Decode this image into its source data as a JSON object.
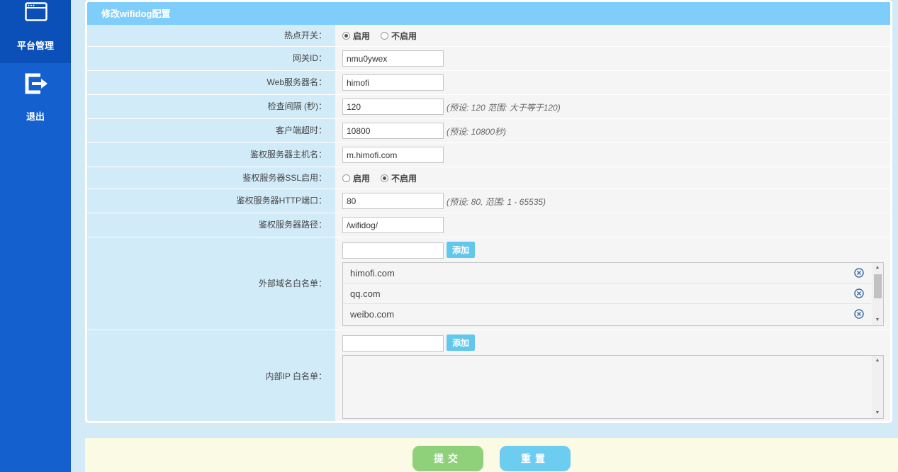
{
  "sidebar": {
    "items": [
      {
        "label": "平台管理",
        "icon": "window-icon"
      },
      {
        "label": "退出",
        "icon": "logout-icon"
      }
    ]
  },
  "form": {
    "title": "修改wifidog配置",
    "hotspot": {
      "label": "热点开关：",
      "options": [
        "启用",
        "不启用"
      ],
      "selected": "启用"
    },
    "gateway_id": {
      "label": "网关ID：",
      "value": "nmu0ywex"
    },
    "web_server": {
      "label": "Web服务器名：",
      "value": "himofi"
    },
    "check_interval": {
      "label": "检查间隔 (秒)：",
      "value": "120",
      "hint": "(预设: 120 范围: 大于等于120)"
    },
    "client_timeout": {
      "label": "客户端超时：",
      "value": "10800",
      "hint": "(预设: 10800秒)"
    },
    "auth_host": {
      "label": "鉴权服务器主机名：",
      "value": "m.himofi.com"
    },
    "auth_ssl": {
      "label": "鉴权服务器SSL启用：",
      "options": [
        "启用",
        "不启用"
      ],
      "selected": "不启用"
    },
    "auth_http_port": {
      "label": "鉴权服务器HTTP端口：",
      "value": "80",
      "hint": "(预设: 80, 范围: 1 - 65535)"
    },
    "auth_path": {
      "label": "鉴权服务器路径：",
      "value": "/wifidog/"
    },
    "domain_whitelist": {
      "label": "外部域名白名单：",
      "input_value": "",
      "add_label": "添加",
      "items": [
        "himofi.com",
        "qq.com",
        "weibo.com"
      ]
    },
    "ip_whitelist": {
      "label": "内部IP 白名单：",
      "input_value": "",
      "add_label": "添加",
      "items": []
    }
  },
  "footer": {
    "submit_label": "提交",
    "reset_label": "重置"
  },
  "colors": {
    "sidebar": "#1560cf",
    "header": "#7ecdfb",
    "label_bg": "#d2ebf8",
    "submit": "#8fd07b",
    "reset": "#6dcdf0"
  }
}
